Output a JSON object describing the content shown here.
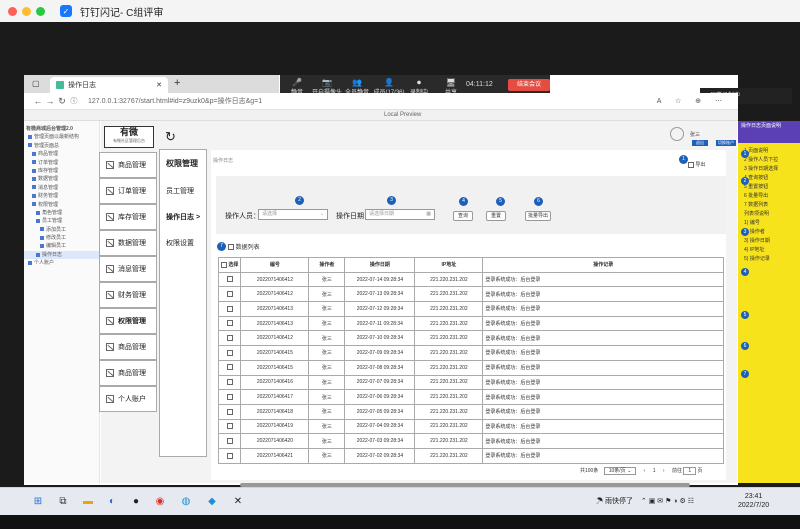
{
  "window": {
    "title": "钉钉闪记- C组评审"
  },
  "meeting": {
    "items": [
      {
        "label": "静音",
        "icon": "🎤"
      },
      {
        "label": "开启摄像头",
        "icon": "📷"
      },
      {
        "label": "全员静音",
        "icon": "👥"
      },
      {
        "label": "成员(17/36)",
        "icon": "👤"
      },
      {
        "label": "录制中",
        "icon": "⏺"
      },
      {
        "label": "共享",
        "icon": "🖥"
      }
    ],
    "timer": "04:11:12",
    "end_label": "结束会议",
    "recording": "屏幕录制中"
  },
  "browser": {
    "tab_title": "操作日志",
    "url": "127.0.0.1:32767/start.html#id=z9uzk0&p=操作日志&g=1",
    "preview_label": "Local Preview"
  },
  "tree": {
    "root": "有微商城后台管理2.0",
    "items": [
      "管理页面以最新结构",
      "管理页面总",
      "商品管理",
      "订单管理",
      "库存管理",
      "数据管理",
      "消息管理",
      "财务管理",
      "权限管理",
      "角色管理",
      "员工管理",
      "添加员工",
      "修改员工",
      "编辑员工",
      "操作日志",
      "个人账户"
    ]
  },
  "app": {
    "logo_title": "有微",
    "logo_sub": "有微社区管理后台",
    "menu": [
      "商品管理",
      "订单管理",
      "库存管理",
      "数据管理",
      "消息管理",
      "财务管理",
      "权限管理",
      "商品管理",
      "商品管理",
      "个人账户"
    ],
    "submenu_title": "权限管理",
    "submenu": [
      "员工管理",
      "操作日志 >",
      "权限设置"
    ],
    "header_user": "张三",
    "header_btn1": "退出",
    "header_btn2": "切换账户",
    "breadcrumb": "操作日志",
    "export_label": "导出",
    "search": {
      "operator_label": "操作人员：",
      "operator_placeholder": "请选择",
      "date_label": "操作日期：",
      "date_placeholder": "请选择日期",
      "query": "查询",
      "reset": "重置",
      "batch_export": "批量导出"
    },
    "data_list_label": "数据列表",
    "table": {
      "headers": [
        "选择",
        "编号",
        "操作者",
        "操作日期",
        "IP地址",
        "操作记录"
      ],
      "rows": [
        [
          "2022071406412",
          "张三",
          "2022-07-14 09:28:34",
          "221.220.231.202",
          "登录系统成功：后台登录"
        ],
        [
          "2022071406412",
          "张三",
          "2022-07-13 09:28:34",
          "221.220.231.202",
          "登录系统成功：后台登录"
        ],
        [
          "2022071406413",
          "张三",
          "2022-07-12 09:28:34",
          "221.220.231.202",
          "登录系统成功：后台登录"
        ],
        [
          "2022071406413",
          "张三",
          "2022-07-11 09:28:34",
          "221.220.231.202",
          "登录系统成功：后台登录"
        ],
        [
          "2022071406412",
          "张三",
          "2022-07-10 09:28:34",
          "221.220.231.202",
          "登录系统成功：后台登录"
        ],
        [
          "2022071406415",
          "张三",
          "2022-07-09 09:28:34",
          "221.220.231.202",
          "登录系统成功：后台登录"
        ],
        [
          "2022071406415",
          "张三",
          "2022-07-08 09:28:34",
          "221.220.231.202",
          "登录系统成功：后台登录"
        ],
        [
          "2022071406416",
          "张三",
          "2022-07-07 09:28:34",
          "221.220.231.202",
          "登录系统成功：后台登录"
        ],
        [
          "2022071406417",
          "张三",
          "2022-07-06 09:28:34",
          "221.220.231.202",
          "登录系统成功：后台登录"
        ],
        [
          "2022071406418",
          "张三",
          "2022-07-05 09:28:34",
          "221.220.231.202",
          "登录系统成功：后台登录"
        ],
        [
          "2022071406419",
          "张三",
          "2022-07-04 09:28:34",
          "221.220.231.202",
          "登录系统成功：后台登录"
        ],
        [
          "2022071406420",
          "张三",
          "2022-07-03 09:28:34",
          "221.220.231.202",
          "登录系统成功：后台登录"
        ],
        [
          "2022071406421",
          "张三",
          "2022-07-02 09:28:34",
          "221.220.231.202",
          "登录系统成功：后台登录"
        ]
      ]
    },
    "pager": {
      "total": "共100条",
      "size": "10条/页",
      "page": "1",
      "goto": "前往",
      "goto_page": "1",
      "goto_suffix": "页"
    }
  },
  "notes": {
    "head": "操作日志页面说明",
    "lines": [
      "1 页面说明",
      "2 操作人员下拉",
      "3 操作日期选择",
      "4 查询按钮",
      "5 重置按钮",
      "6 批量导出",
      "7 数据列表",
      "列表项说明",
      "1) 编号",
      "2) 操作者",
      "3) 操作日期",
      "4) IP地址",
      "5) 操作记录"
    ]
  },
  "taskbar": {
    "tray_text": "雨快停了",
    "time": "23:41",
    "date": "2022/7/20"
  }
}
